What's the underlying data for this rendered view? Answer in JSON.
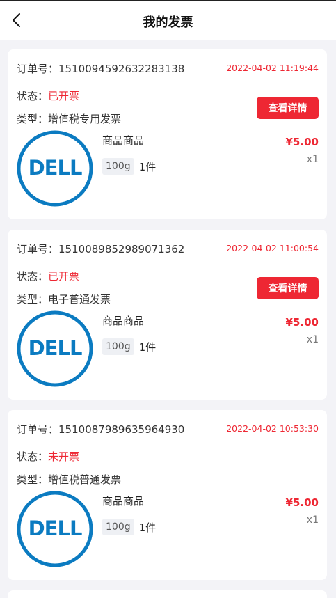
{
  "header": {
    "title": "我的发票"
  },
  "labels": {
    "order_no": "订单号：",
    "status": "状态：",
    "type": "类型：",
    "detail_button": "查看详情",
    "logo_text": "DELL"
  },
  "colors": {
    "accent": "#ee2733",
    "dell_blue": "#0b7bc1",
    "background": "#f3f3f7"
  },
  "orders": [
    {
      "order_no": "1510094592632283138",
      "date": "2022-04-02 11:19:44",
      "status": "已开票",
      "type": "增值税专用发票",
      "has_detail_button": true,
      "goods_name": "商品商品",
      "spec": "100g",
      "qty_text": "1件",
      "price": "¥5.00",
      "count": "x1",
      "thumb_icon": "dell-logo-icon"
    },
    {
      "order_no": "1510089852989071362",
      "date": "2022-04-02 11:00:54",
      "status": "已开票",
      "type": "电子普通发票",
      "has_detail_button": true,
      "goods_name": "商品商品",
      "spec": "100g",
      "qty_text": "1件",
      "price": "¥5.00",
      "count": "x1",
      "thumb_icon": "dell-logo-icon"
    },
    {
      "order_no": "1510087989635964930",
      "date": "2022-04-02 10:53:30",
      "status": "未开票",
      "type": "增值税普通发票",
      "has_detail_button": false,
      "goods_name": "商品商品",
      "spec": "100g",
      "qty_text": "1件",
      "price": "¥5.00",
      "count": "x1",
      "thumb_icon": "dell-logo-icon"
    }
  ]
}
